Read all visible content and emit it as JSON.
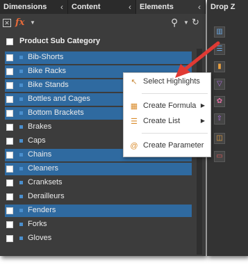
{
  "tabs": [
    {
      "label": "Dimensions"
    },
    {
      "label": "Content"
    },
    {
      "label": "Elements"
    }
  ],
  "drop_panel": {
    "title": "Drop Z"
  },
  "toolbar": {
    "fx_label": "fx"
  },
  "list_header": "Product Sub Category",
  "items": [
    {
      "label": "Bib-Shorts",
      "highlighted": true
    },
    {
      "label": "Bike Racks",
      "highlighted": true
    },
    {
      "label": "Bike Stands",
      "highlighted": true
    },
    {
      "label": "Bottles and Cages",
      "highlighted": true
    },
    {
      "label": "Bottom Brackets",
      "highlighted": true
    },
    {
      "label": "Brakes",
      "highlighted": false
    },
    {
      "label": "Caps",
      "highlighted": false
    },
    {
      "label": "Chains",
      "highlighted": true
    },
    {
      "label": "Cleaners",
      "highlighted": true
    },
    {
      "label": "Cranksets",
      "highlighted": false
    },
    {
      "label": "Derailleurs",
      "highlighted": false
    },
    {
      "label": "Fenders",
      "highlighted": true
    },
    {
      "label": "Forks",
      "highlighted": false
    },
    {
      "label": "Gloves",
      "highlighted": false
    }
  ],
  "context_menu": {
    "select_highlights": "Select Highlights",
    "create_formula": "Create Formula",
    "create_list": "Create List",
    "create_parameter": "Create Parameter"
  },
  "colors": {
    "panel_bg": "#3c3c3c",
    "highlight": "#2f6aa0",
    "item_square": "#4a8fce",
    "arrow": "#e03a34"
  },
  "icons": {
    "toolbar": [
      "close-box-icon",
      "fx-icon",
      "caret-down-icon",
      "search-icon",
      "caret-down-icon",
      "refresh-icon"
    ],
    "menu": [
      "cursor-highlight-icon",
      "formula-icon",
      "list-icon",
      "parameter-icon"
    ],
    "drop_zone": [
      "columns-icon",
      "rows-icon",
      "chart-icon",
      "filter-icon",
      "color-icon",
      "upload-icon",
      "save-icon",
      "comment-icon"
    ]
  }
}
